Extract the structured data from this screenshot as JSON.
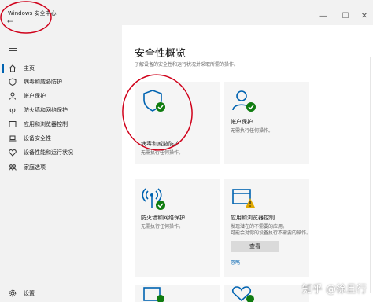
{
  "window": {
    "title": "Windows 安全中心",
    "back_glyph": "←",
    "minimize_glyph": "—",
    "maximize_glyph": "☐",
    "close_glyph": "✕"
  },
  "sidebar": {
    "items": [
      {
        "label": "主页",
        "icon": "home-icon",
        "selected": true
      },
      {
        "label": "病毒和威胁防护",
        "icon": "shield-icon"
      },
      {
        "label": "帐户保护",
        "icon": "person-icon"
      },
      {
        "label": "防火墙和网络保护",
        "icon": "wifi-icon"
      },
      {
        "label": "应用和浏览器控制",
        "icon": "app-window-icon"
      },
      {
        "label": "设备安全性",
        "icon": "laptop-icon"
      },
      {
        "label": "设备性能和运行状况",
        "icon": "heart-icon"
      },
      {
        "label": "家庭选项",
        "icon": "family-icon"
      }
    ],
    "settings_label": "设置"
  },
  "main": {
    "title": "安全性概览",
    "subtitle": "了解设备的安全性和运行状况并采取所需的操作。",
    "cards": [
      {
        "title": "病毒和威胁防护",
        "status": "无需执行任何操作。",
        "icon": "shield-check-icon"
      },
      {
        "title": "帐户保护",
        "status": "无需执行任何操作。",
        "icon": "account-check-icon"
      },
      {
        "title": "防火墙和网络保护",
        "status": "无需执行任何操作。",
        "icon": "wifi-check-icon"
      },
      {
        "title": "应用和浏览器控制",
        "status": "发现潜在的不需要的应用。",
        "status2": "可能会对你的设备执行不需要的操作。",
        "button": "查看",
        "link": "忽略",
        "icon": "app-warning-icon"
      }
    ]
  },
  "watermark": "知乎 @徐且行",
  "colors": {
    "accent": "#0063b1",
    "ok": "#107c10",
    "warn": "#e0a800",
    "annotation": "#d0021b"
  }
}
